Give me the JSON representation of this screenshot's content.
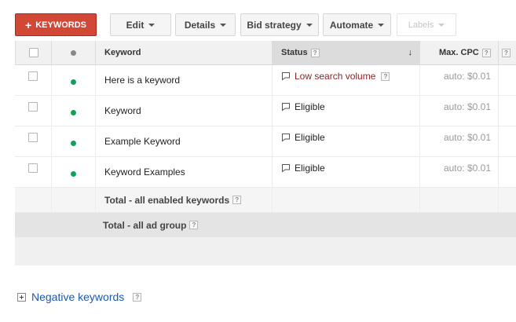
{
  "toolbar": {
    "keywords_label": "KEYWORDS",
    "edit_label": "Edit",
    "details_label": "Details",
    "bid_strategy_label": "Bid strategy",
    "automate_label": "Automate",
    "labels_label": "Labels"
  },
  "table": {
    "headers": {
      "keyword": "Keyword",
      "status": "Status",
      "max_cpc": "Max. CPC",
      "help_glyph": "?"
    },
    "rows": [
      {
        "keyword": "Here is a keyword",
        "status": "Low search volume",
        "status_color": "#8c1f1f",
        "max_cpc": "auto: $0.01"
      },
      {
        "keyword": "Keyword",
        "status": "Eligible",
        "status_color": "#222222",
        "max_cpc": "auto: $0.01"
      },
      {
        "keyword": "Example Keyword",
        "status": "Eligible",
        "status_color": "#222222",
        "max_cpc": "auto: $0.01"
      },
      {
        "keyword": "Keyword Examples",
        "status": "Eligible",
        "status_color": "#222222",
        "max_cpc": "auto: $0.01"
      }
    ],
    "total_enabled_label": "Total - all enabled keywords",
    "total_ad_group_label": "Total - all ad group"
  },
  "negative_keywords_label": "Negative keywords",
  "colors": {
    "accent_red": "#d14836",
    "status_green": "#10a25a",
    "link_blue": "#1a58b0"
  }
}
